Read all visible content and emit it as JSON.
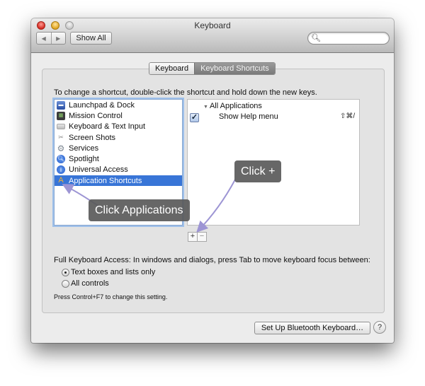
{
  "window": {
    "title": "Keyboard",
    "nav_back": "◀",
    "nav_forward": "▶",
    "show_all_label": "Show All",
    "search_placeholder": "",
    "search_icon": "magnifier-icon"
  },
  "tabs": [
    {
      "label": "Keyboard",
      "active": false
    },
    {
      "label": "Keyboard Shortcuts",
      "active": true
    }
  ],
  "instruction": "To change a shortcut, double-click the shortcut and hold down the new keys.",
  "categories": [
    {
      "label": "Launchpad & Dock",
      "icon": "launchpad-dock-icon",
      "selected": false
    },
    {
      "label": "Mission Control",
      "icon": "mission-control-icon",
      "selected": false
    },
    {
      "label": "Keyboard & Text Input",
      "icon": "keyboard-icon",
      "selected": false
    },
    {
      "label": "Screen Shots",
      "icon": "screenshot-icon",
      "selected": false
    },
    {
      "label": "Services",
      "icon": "services-gear-icon",
      "selected": false
    },
    {
      "label": "Spotlight",
      "icon": "spotlight-icon",
      "selected": false
    },
    {
      "label": "Universal Access",
      "icon": "universal-access-icon",
      "selected": false
    },
    {
      "label": "Application Shortcuts",
      "icon": "app-shortcuts-icon",
      "selected": true
    }
  ],
  "shortcuts": {
    "group_label": "All Applications",
    "items": [
      {
        "name": "Show Help menu",
        "keys": "⇧⌘/",
        "enabled": true
      }
    ]
  },
  "add_remove": {
    "add": "+",
    "remove": "−"
  },
  "full_keyboard_access": {
    "label": "Full Keyboard Access: In windows and dialogs, press Tab to move keyboard focus between:",
    "options": [
      {
        "label": "Text boxes and lists only",
        "selected": true
      },
      {
        "label": "All controls",
        "selected": false
      }
    ],
    "hint": "Press Control+F7 to change this setting."
  },
  "footer": {
    "bluetooth_button": "Set Up Bluetooth Keyboard…",
    "help_button": "?"
  },
  "annotations": {
    "click_applications": "Click Applications",
    "click_plus": "Click +",
    "arrow_color": "#9d95d4"
  }
}
